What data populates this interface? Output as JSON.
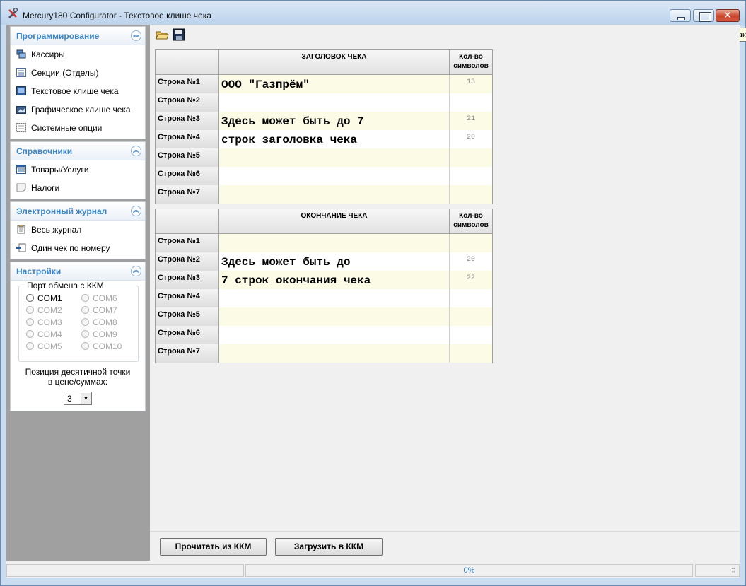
{
  "window": {
    "title": "Mercury180 Configurator - Текстовое клише чека",
    "tooltip": "Закрыть",
    "close_glyph": "✕",
    "icon": "tools-icon"
  },
  "sidebar": {
    "programming": {
      "title": "Программирование",
      "items": [
        {
          "label": "Кассиры",
          "icon": "cashiers-icon"
        },
        {
          "label": "Секции (Отделы)",
          "icon": "sections-icon"
        },
        {
          "label": "Текстовое клише чека",
          "icon": "text-cliche-icon"
        },
        {
          "label": "Графическое клише чека",
          "icon": "graphic-cliche-icon"
        },
        {
          "label": "Системные опции",
          "icon": "system-options-icon"
        }
      ]
    },
    "references": {
      "title": "Справочники",
      "items": [
        {
          "label": "Товары/Услуги",
          "icon": "goods-icon"
        },
        {
          "label": "Налоги",
          "icon": "taxes-icon"
        }
      ]
    },
    "journal": {
      "title": "Электронный журнал",
      "items": [
        {
          "label": "Весь журнал",
          "icon": "full-journal-icon"
        },
        {
          "label": "Один чек по номеру",
          "icon": "one-receipt-icon"
        }
      ]
    },
    "settings": {
      "title": "Настройки",
      "port_legend": "Порт обмена с ККМ",
      "ports": [
        {
          "label": "COM1",
          "enabled": true
        },
        {
          "label": "COM2",
          "enabled": false
        },
        {
          "label": "COM3",
          "enabled": false
        },
        {
          "label": "COM4",
          "enabled": false
        },
        {
          "label": "COM5",
          "enabled": false
        },
        {
          "label": "COM6",
          "enabled": false
        },
        {
          "label": "COM7",
          "enabled": false
        },
        {
          "label": "COM8",
          "enabled": false
        },
        {
          "label": "COM9",
          "enabled": false
        },
        {
          "label": "COM10",
          "enabled": false
        }
      ],
      "decimal_label_1": "Позиция десятичной точки",
      "decimal_label_2": "в цене/суммах:",
      "decimal_value": "3"
    }
  },
  "toolbar": {
    "open_icon": "open-folder-icon",
    "save_icon": "save-disk-icon"
  },
  "header_table": {
    "title": "ЗАГОЛОВОК ЧЕКА",
    "count_header_1": "Кол-во",
    "count_header_2": "символов",
    "rows": [
      {
        "label": "Строка №1",
        "text": "ООО \"Газпрём\"",
        "count": "13"
      },
      {
        "label": "Строка №2",
        "text": "",
        "count": ""
      },
      {
        "label": "Строка №3",
        "text": "Здесь может быть до 7",
        "count": "21"
      },
      {
        "label": "Строка №4",
        "text": "строк заголовка чека",
        "count": "20"
      },
      {
        "label": "Строка №5",
        "text": "",
        "count": ""
      },
      {
        "label": "Строка №6",
        "text": "",
        "count": ""
      },
      {
        "label": "Строка №7",
        "text": "",
        "count": ""
      }
    ]
  },
  "footer_table": {
    "title": "ОКОНЧАНИЕ ЧЕКА",
    "count_header_1": "Кол-во",
    "count_header_2": "символов",
    "rows": [
      {
        "label": "Строка №1",
        "text": "",
        "count": ""
      },
      {
        "label": "Строка №2",
        "text": "Здесь может быть до",
        "count": "20"
      },
      {
        "label": "Строка №3",
        "text": "7 строк окончания чека",
        "count": "22"
      },
      {
        "label": "Строка №4",
        "text": "",
        "count": ""
      },
      {
        "label": "Строка №5",
        "text": "",
        "count": ""
      },
      {
        "label": "Строка №6",
        "text": "",
        "count": ""
      },
      {
        "label": "Строка №7",
        "text": "",
        "count": ""
      }
    ]
  },
  "buttons": {
    "read": "Прочитать из ККМ",
    "load": "Загрузить в ККМ"
  },
  "status": {
    "progress": "0%"
  }
}
